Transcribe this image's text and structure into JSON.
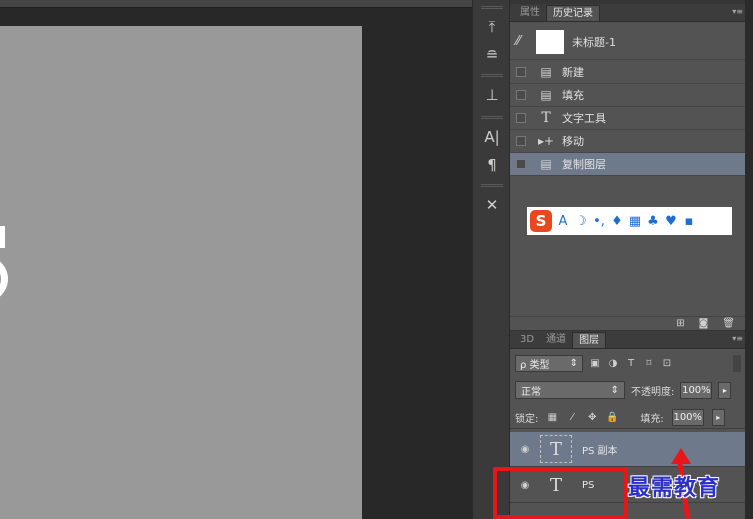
{
  "dock_tools": [
    {
      "icon": "brush-preset-icon",
      "glyph": "⤒"
    },
    {
      "icon": "brush-settings-icon",
      "glyph": "≘"
    },
    {
      "icon": "clone-source-icon",
      "glyph": "⊥"
    },
    {
      "icon": "character-icon",
      "glyph": "A|"
    },
    {
      "icon": "paragraph-icon",
      "glyph": "¶"
    },
    {
      "icon": "tool-presets-icon",
      "glyph": "✕"
    }
  ],
  "history_panel": {
    "tabs": [
      {
        "label": "属性",
        "active": false
      },
      {
        "label": "历史记录",
        "active": true
      }
    ],
    "snapshot": {
      "label": "未标题-1"
    },
    "items": [
      {
        "label": "新建",
        "icon": "document-icon",
        "glyph": "▤",
        "selected": false
      },
      {
        "label": "填充",
        "icon": "fill-icon",
        "glyph": "▤",
        "selected": false
      },
      {
        "label": "文字工具",
        "icon": "type-icon",
        "glyph": "T",
        "selected": false
      },
      {
        "label": "移动",
        "icon": "move-icon",
        "glyph": "▸+",
        "selected": false
      },
      {
        "label": "复制图层",
        "icon": "layer-icon",
        "glyph": "▤",
        "selected": true
      }
    ],
    "footer_icons": [
      "new-document-from-state-icon",
      "snapshot-camera-icon",
      "trash-icon"
    ]
  },
  "ime_toolbar": {
    "logo": "S",
    "buttons": [
      {
        "icon": "chinese-english-icon",
        "glyph": "A"
      },
      {
        "icon": "moon-icon",
        "glyph": "☽"
      },
      {
        "icon": "punctuation-icon",
        "glyph": "•,"
      },
      {
        "icon": "microphone-icon",
        "glyph": "♦"
      },
      {
        "icon": "keyboard-icon",
        "glyph": "▦"
      },
      {
        "icon": "user-icon",
        "glyph": "♣"
      },
      {
        "icon": "skin-icon",
        "glyph": "♥"
      },
      {
        "icon": "grid-icon",
        "glyph": "▪"
      }
    ]
  },
  "layers_panel": {
    "tabs": [
      {
        "label": "3D",
        "active": false
      },
      {
        "label": "通道",
        "active": false
      },
      {
        "label": "图层",
        "active": true
      }
    ],
    "filter": {
      "label": "ρ 类型",
      "arrow": "⇕"
    },
    "blend_mode": {
      "value": "正常",
      "arrow": "⇕"
    },
    "opacity": {
      "label": "不透明度:",
      "value": "100%"
    },
    "lock": {
      "label": "锁定:"
    },
    "fill": {
      "label": "填充:",
      "value": "100%"
    },
    "layers": [
      {
        "name": "PS 副本",
        "thumb": "T",
        "selected": true
      },
      {
        "name": "PS",
        "thumb": "T",
        "selected": false
      }
    ]
  },
  "watermark": "最需教育"
}
